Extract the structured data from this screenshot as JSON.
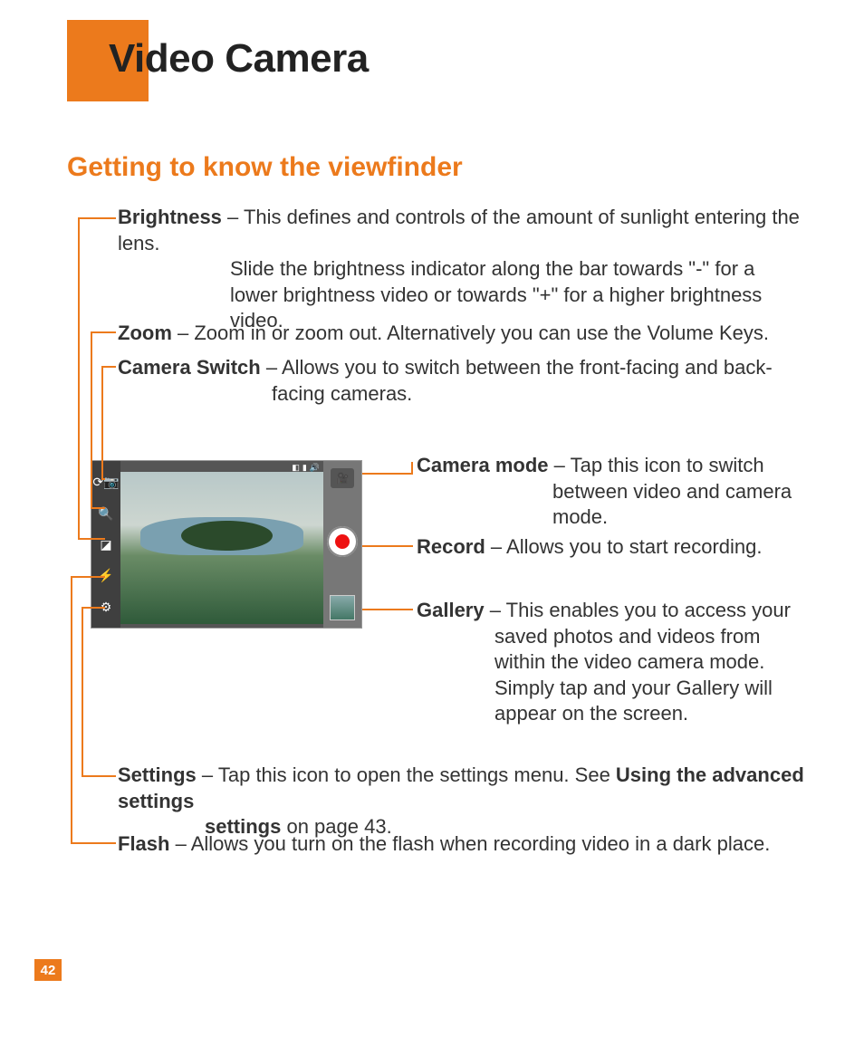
{
  "page_number": "42",
  "title": "Video Camera",
  "section": "Getting to know the viewfinder",
  "callouts": {
    "brightness": {
      "label": "Brightness",
      "text": " – This defines and controls of the amount of sunlight entering the lens. Slide the brightness indicator along the bar towards \"-\" for a lower brightness video or towards \"+\" for a higher brightness video."
    },
    "zoom": {
      "label": "Zoom",
      "text": " – Zoom in or zoom out. Alternatively you can use the Volume Keys."
    },
    "camera_switch": {
      "label": "Camera Switch",
      "text": " – Allows you to switch between the front-facing and back-facing cameras."
    },
    "camera_mode": {
      "label": "Camera mode",
      "text": " – Tap this icon to switch between video and camera mode."
    },
    "record": {
      "label": "Record",
      "text": " – Allows you to start recording."
    },
    "gallery": {
      "label": "Gallery",
      "text": " – This enables you to access your saved photos and videos from within the video camera mode. Simply tap and your Gallery will appear on the screen."
    },
    "settings": {
      "label": "Settings",
      "text_a": " – Tap this icon to open the settings menu. See ",
      "bold": "Using the advanced settings",
      "text_b": " on page 43."
    },
    "flash": {
      "label": "Flash",
      "text": " – Allows you turn on the flash when recording video in a dark place."
    }
  },
  "icons": {
    "switch": "camera-switch-icon",
    "zoom": "zoom-icon",
    "brightness": "brightness-icon",
    "flash": "flash-icon",
    "settings": "settings-icon",
    "mode": "camera-mode-icon",
    "record": "record-icon",
    "gallery": "gallery-icon"
  }
}
